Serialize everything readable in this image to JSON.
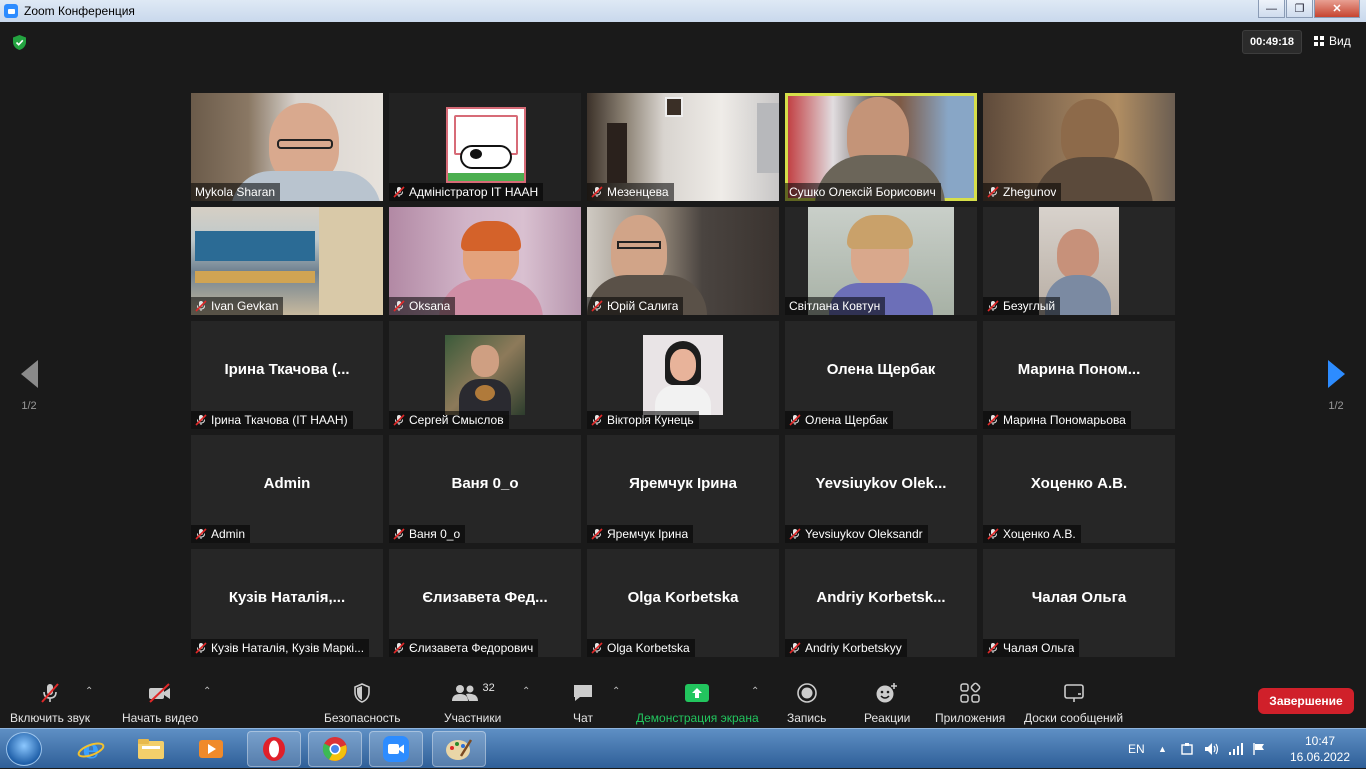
{
  "window": {
    "title": "Zoom Конференция",
    "min": "—",
    "max": "❐",
    "close": "✕"
  },
  "meeting": {
    "timer": "00:49:18",
    "view_label": "Вид",
    "page_left": "1/2",
    "page_right": "1/2"
  },
  "tiles": [
    {
      "label": "Mykola Sharan",
      "bigname": "",
      "muted": false,
      "video": "v1",
      "active": false
    },
    {
      "label": "Адміністратор ІТ НААН",
      "bigname": "",
      "muted": true,
      "video": "v2",
      "active": false
    },
    {
      "label": "Мезенцева",
      "bigname": "",
      "muted": true,
      "video": "v3",
      "active": false
    },
    {
      "label": "Сушко Олексій Борисович",
      "bigname": "",
      "muted": false,
      "video": "v4",
      "active": true
    },
    {
      "label": "Zhegunov",
      "bigname": "",
      "muted": true,
      "video": "v5",
      "active": false
    },
    {
      "label": "Ivan Gevkan",
      "bigname": "",
      "muted": true,
      "video": "v6",
      "active": false
    },
    {
      "label": "Oksana",
      "bigname": "",
      "muted": true,
      "video": "v7",
      "active": false
    },
    {
      "label": "Юрій Салига",
      "bigname": "",
      "muted": true,
      "video": "v8",
      "active": false
    },
    {
      "label": "Світлана Ковтун",
      "bigname": "",
      "muted": false,
      "video": "v9",
      "active": false
    },
    {
      "label": "Безуглый",
      "bigname": "",
      "muted": true,
      "video": "v10",
      "active": false
    },
    {
      "label": "Ірина Ткачова (ІТ НААН)",
      "bigname": "Ірина Ткачова (...",
      "muted": true,
      "video": "",
      "active": false
    },
    {
      "label": "Сергей Смыслов",
      "bigname": "",
      "muted": true,
      "video": "photo1",
      "active": false
    },
    {
      "label": "Вікторія Кунець",
      "bigname": "",
      "muted": true,
      "video": "photo2",
      "active": false
    },
    {
      "label": "Олена Щербак",
      "bigname": "Олена Щербак",
      "muted": true,
      "video": "",
      "active": false
    },
    {
      "label": "Марина Пономарьова",
      "bigname": "Марина  Поном...",
      "muted": true,
      "video": "",
      "active": false
    },
    {
      "label": "Admin",
      "bigname": "Admin",
      "muted": true,
      "video": "",
      "active": false
    },
    {
      "label": "Ваня 0_о",
      "bigname": "Ваня 0_о",
      "muted": true,
      "video": "",
      "active": false
    },
    {
      "label": "Яремчук Ірина",
      "bigname": "Яремчук Ірина",
      "muted": true,
      "video": "",
      "active": false
    },
    {
      "label": "Yevsiuykov Oleksandr",
      "bigname": "Yevsiuykov  Olek...",
      "muted": true,
      "video": "",
      "active": false
    },
    {
      "label": "Хоценко А.В.",
      "bigname": "Хоценко А.В.",
      "muted": true,
      "video": "",
      "active": false
    },
    {
      "label": "Кузів Наталія, Кузів Маркі...",
      "bigname": "Кузів Наталія,...",
      "muted": true,
      "video": "",
      "active": false
    },
    {
      "label": "Єлизавета Федорович",
      "bigname": "Єлизавета  Фед...",
      "muted": true,
      "video": "",
      "active": false
    },
    {
      "label": "Olga Korbetska",
      "bigname": "Olga Korbetska",
      "muted": true,
      "video": "",
      "active": false
    },
    {
      "label": "Andriy Korbetskyy",
      "bigname": "Andriy  Korbetsk...",
      "muted": true,
      "video": "",
      "active": false
    },
    {
      "label": "Чалая Ольга",
      "bigname": "Чалая Ольга",
      "muted": true,
      "video": "",
      "active": false
    }
  ],
  "toolbar": {
    "audio": "Включить звук",
    "video": "Начать видео",
    "security": "Безопасность",
    "participants": "Участники",
    "participants_count": "32",
    "chat": "Чат",
    "share": "Демонстрация экрана",
    "record": "Запись",
    "reactions": "Реакции",
    "apps": "Приложения",
    "whiteboards": "Доски сообщений",
    "end": "Завершение"
  },
  "taskbar": {
    "lang": "EN",
    "time": "10:47",
    "date": "16.06.2022"
  },
  "colors": {
    "active_speaker": "#d6df4a",
    "share_green": "#22c55e",
    "end_red": "#d0202a",
    "nav_blue": "#2d8cff"
  }
}
